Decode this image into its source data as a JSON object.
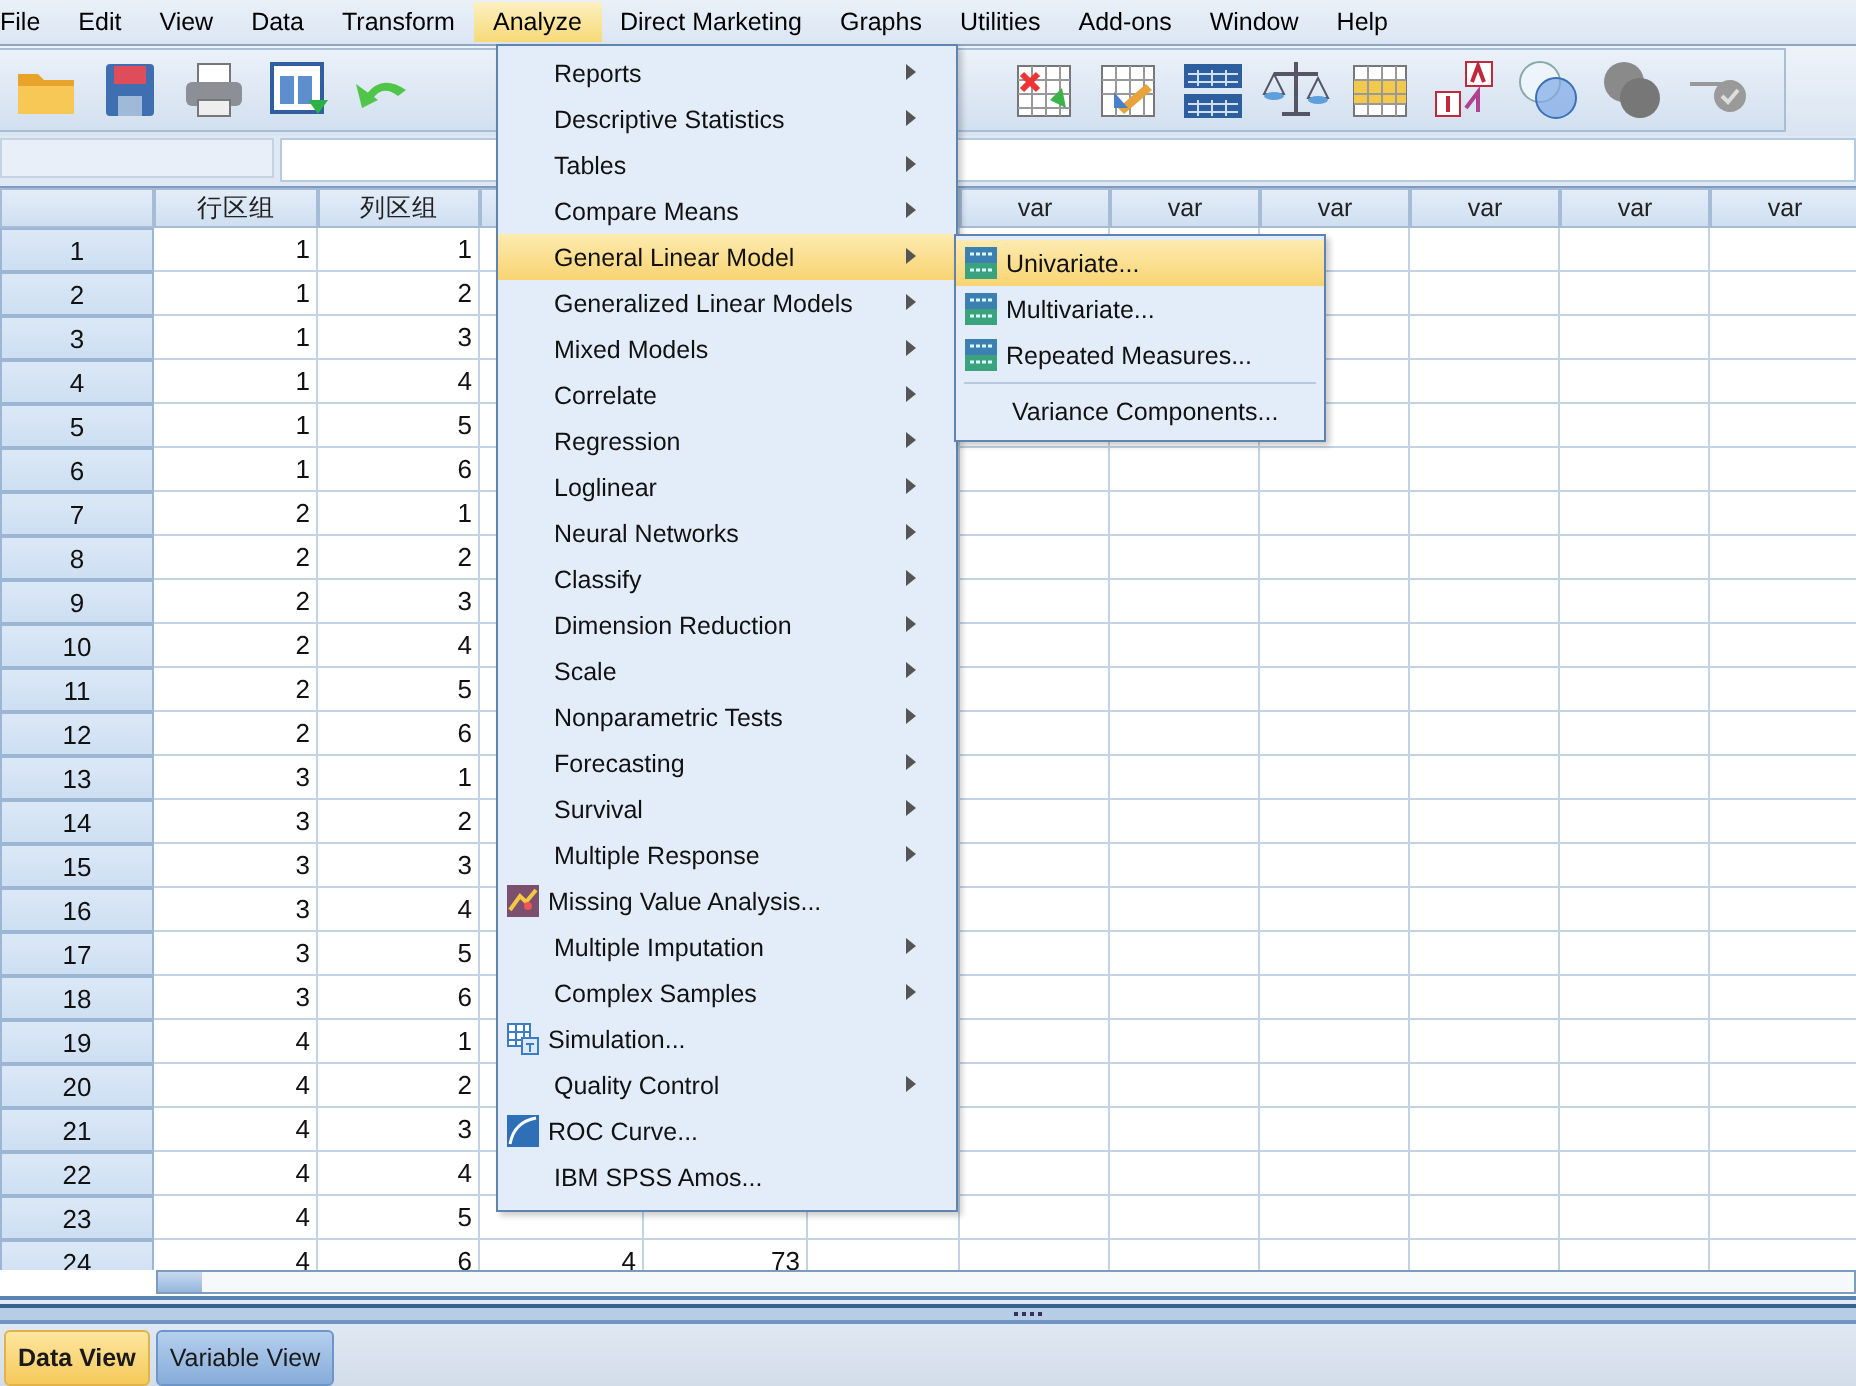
{
  "menubar": [
    {
      "label": "File",
      "selected": false
    },
    {
      "label": "Edit",
      "selected": false
    },
    {
      "label": "View",
      "selected": false
    },
    {
      "label": "Data",
      "selected": false
    },
    {
      "label": "Transform",
      "selected": false
    },
    {
      "label": "Analyze",
      "selected": true
    },
    {
      "label": "Direct Marketing",
      "selected": false
    },
    {
      "label": "Graphs",
      "selected": false
    },
    {
      "label": "Utilities",
      "selected": false
    },
    {
      "label": "Add-ons",
      "selected": false
    },
    {
      "label": "Window",
      "selected": false
    },
    {
      "label": "Help",
      "selected": false
    }
  ],
  "grid": {
    "columns": [
      "行区组",
      "列区组"
    ],
    "var_columns": [
      "var",
      "var",
      "var",
      "var",
      "var",
      "var"
    ],
    "rows": [
      {
        "number": "1",
        "cells": [
          "1",
          "1"
        ]
      },
      {
        "number": "2",
        "cells": [
          "1",
          "2"
        ]
      },
      {
        "number": "3",
        "cells": [
          "1",
          "3"
        ]
      },
      {
        "number": "4",
        "cells": [
          "1",
          "4"
        ]
      },
      {
        "number": "5",
        "cells": [
          "1",
          "5"
        ]
      },
      {
        "number": "6",
        "cells": [
          "1",
          "6"
        ]
      },
      {
        "number": "7",
        "cells": [
          "2",
          "1"
        ]
      },
      {
        "number": "8",
        "cells": [
          "2",
          "2"
        ]
      },
      {
        "number": "9",
        "cells": [
          "2",
          "3"
        ]
      },
      {
        "number": "10",
        "cells": [
          "2",
          "4"
        ]
      },
      {
        "number": "11",
        "cells": [
          "2",
          "5"
        ]
      },
      {
        "number": "12",
        "cells": [
          "2",
          "6"
        ]
      },
      {
        "number": "13",
        "cells": [
          "3",
          "1"
        ]
      },
      {
        "number": "14",
        "cells": [
          "3",
          "2"
        ]
      },
      {
        "number": "15",
        "cells": [
          "3",
          "3"
        ]
      },
      {
        "number": "16",
        "cells": [
          "3",
          "4"
        ]
      },
      {
        "number": "17",
        "cells": [
          "3",
          "5"
        ]
      },
      {
        "number": "18",
        "cells": [
          "3",
          "6"
        ]
      },
      {
        "number": "19",
        "cells": [
          "4",
          "1"
        ]
      },
      {
        "number": "20",
        "cells": [
          "4",
          "2"
        ]
      },
      {
        "number": "21",
        "cells": [
          "4",
          "3"
        ]
      },
      {
        "number": "22",
        "cells": [
          "4",
          "4"
        ]
      },
      {
        "number": "23",
        "cells": [
          "4",
          "5"
        ]
      },
      {
        "number": "24",
        "cells": [
          "4",
          "6",
          "4",
          "73"
        ]
      }
    ]
  },
  "analyze_menu": [
    {
      "label": "Reports",
      "kind": "submenu",
      "selected": false
    },
    {
      "label": "Descriptive Statistics",
      "kind": "submenu",
      "selected": false
    },
    {
      "label": "Tables",
      "kind": "submenu",
      "selected": false
    },
    {
      "label": "Compare Means",
      "kind": "submenu",
      "selected": false
    },
    {
      "label": "General Linear Model",
      "kind": "submenu",
      "selected": true
    },
    {
      "label": "Generalized Linear Models",
      "kind": "submenu",
      "selected": false
    },
    {
      "label": "Mixed Models",
      "kind": "submenu",
      "selected": false
    },
    {
      "label": "Correlate",
      "kind": "submenu",
      "selected": false
    },
    {
      "label": "Regression",
      "kind": "submenu",
      "selected": false
    },
    {
      "label": "Loglinear",
      "kind": "submenu",
      "selected": false
    },
    {
      "label": "Neural Networks",
      "kind": "submenu",
      "selected": false
    },
    {
      "label": "Classify",
      "kind": "submenu",
      "selected": false
    },
    {
      "label": "Dimension Reduction",
      "kind": "submenu",
      "selected": false
    },
    {
      "label": "Scale",
      "kind": "submenu",
      "selected": false
    },
    {
      "label": "Nonparametric Tests",
      "kind": "submenu",
      "selected": false
    },
    {
      "label": "Forecasting",
      "kind": "submenu",
      "selected": false
    },
    {
      "label": "Survival",
      "kind": "submenu",
      "selected": false
    },
    {
      "label": "Multiple Response",
      "kind": "submenu",
      "selected": false
    },
    {
      "label": "Missing Value Analysis...",
      "kind": "missing",
      "selected": false
    },
    {
      "label": "Multiple Imputation",
      "kind": "submenu",
      "selected": false
    },
    {
      "label": "Complex Samples",
      "kind": "submenu",
      "selected": false
    },
    {
      "label": "Simulation...",
      "kind": "simulation",
      "selected": false
    },
    {
      "label": "Quality Control",
      "kind": "submenu",
      "selected": false
    },
    {
      "label": "ROC Curve...",
      "kind": "roc",
      "selected": false
    },
    {
      "label": "IBM SPSS Amos...",
      "kind": "plain",
      "selected": false
    }
  ],
  "glm_submenu": [
    {
      "label": "Univariate...",
      "kind": "glm",
      "selected": true
    },
    {
      "label": "Multivariate...",
      "kind": "glm",
      "selected": false
    },
    {
      "label": "Repeated Measures...",
      "kind": "glm",
      "selected": false
    },
    {
      "label": "Variance Components...",
      "kind": "plain",
      "selected": false
    }
  ],
  "tabs": [
    {
      "label": "Data View",
      "selected": true
    },
    {
      "label": "Variable View",
      "selected": false
    }
  ]
}
